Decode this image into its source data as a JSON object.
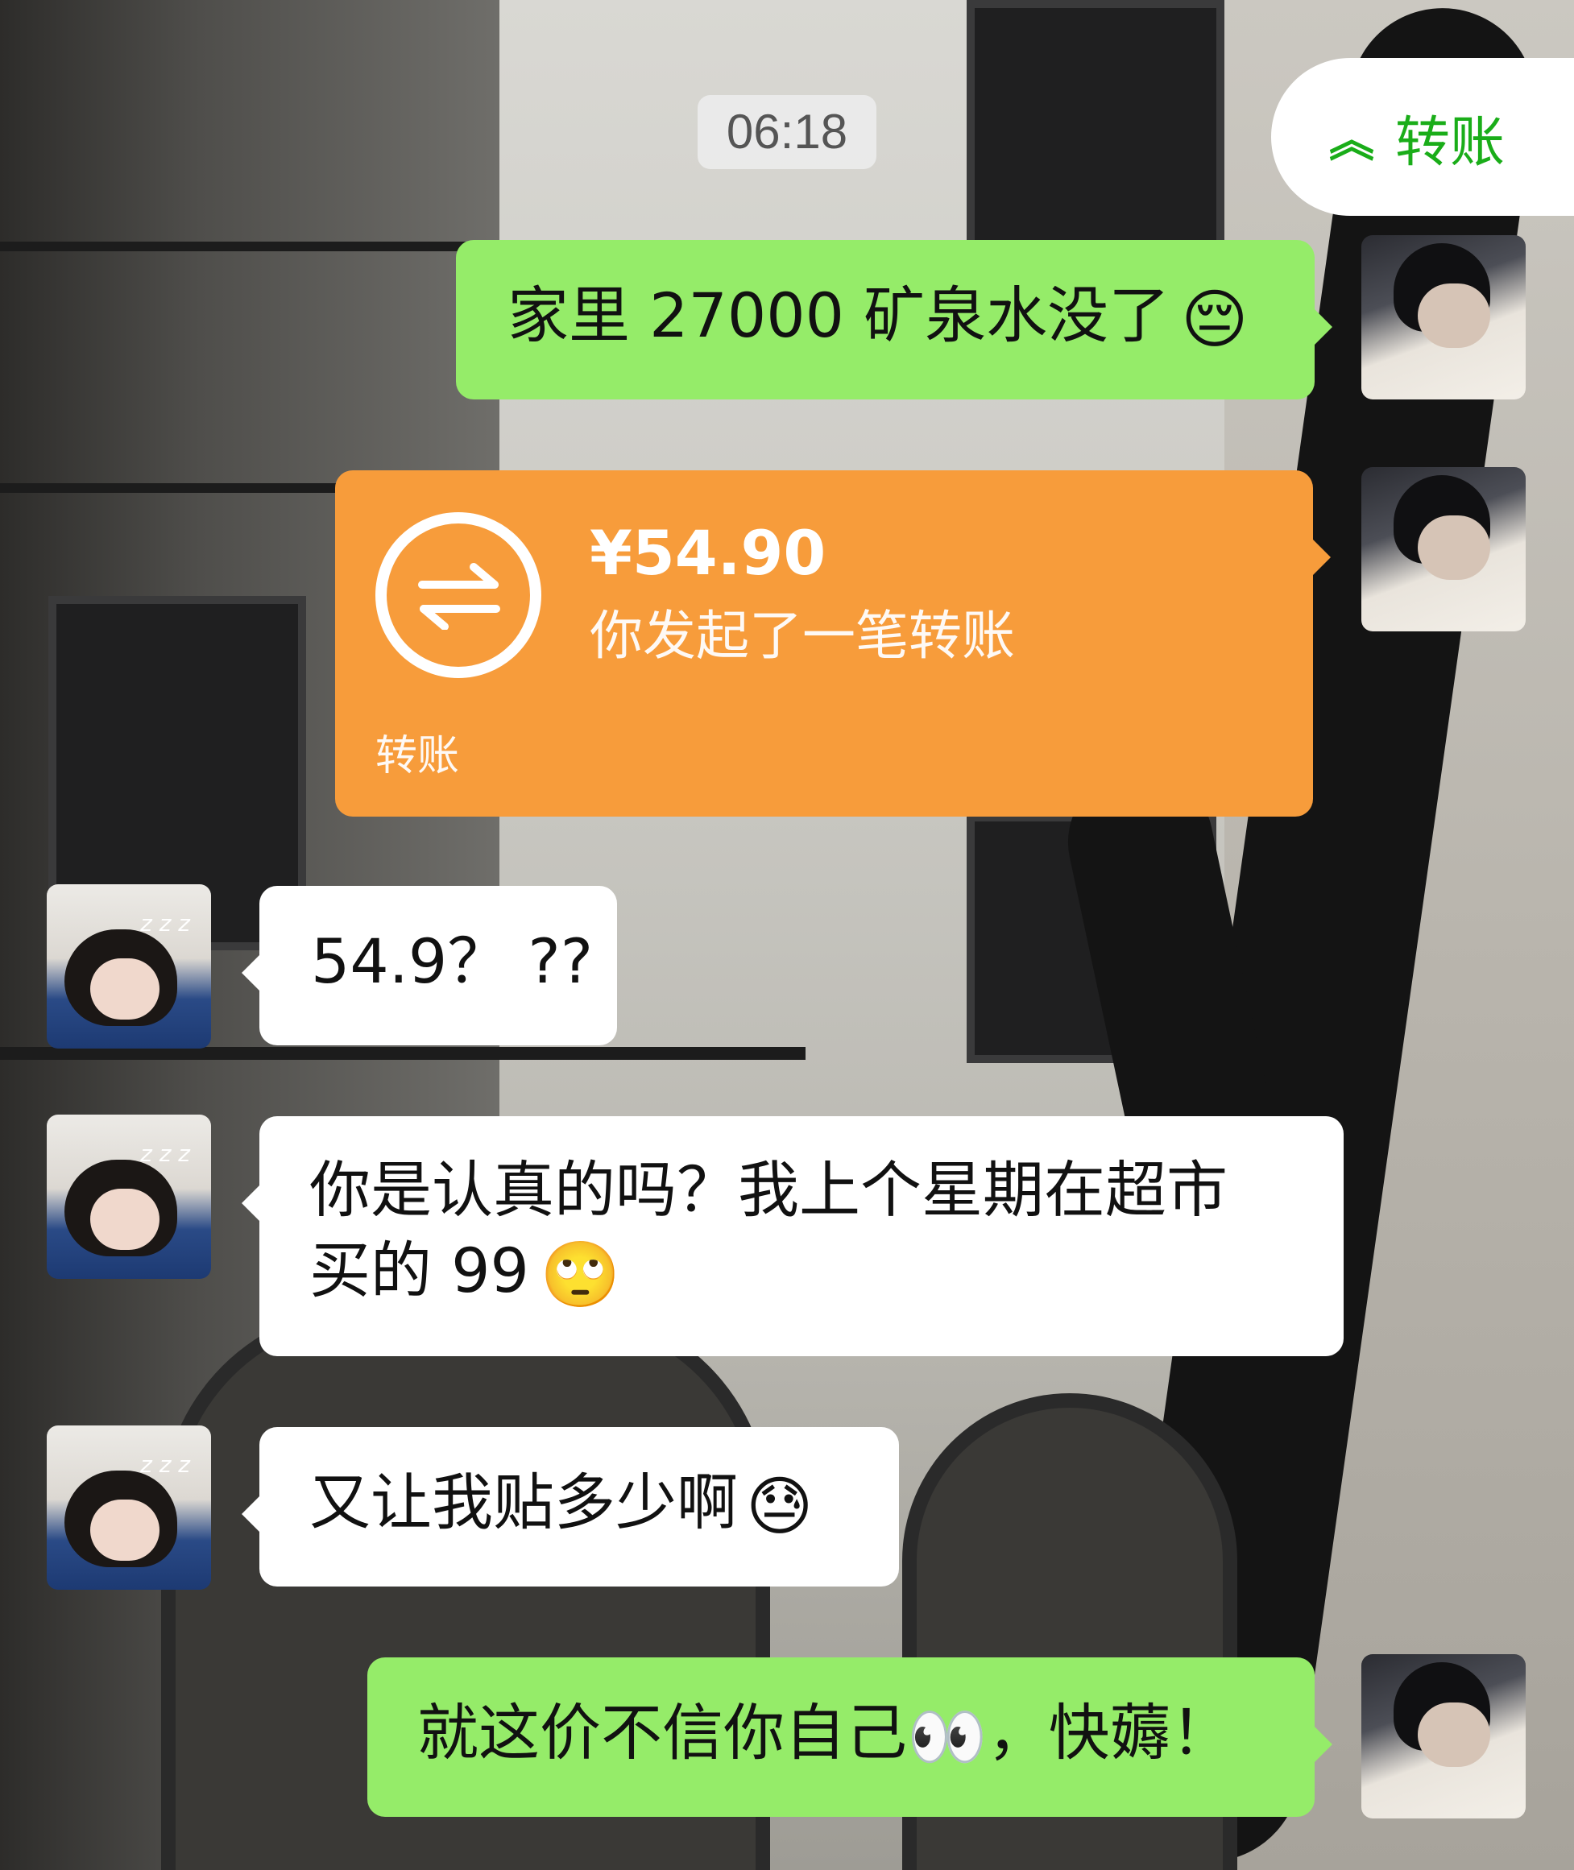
{
  "time_divider": "06:18",
  "transfer_chip": {
    "label": "转账",
    "icon": "chevron-up-double-icon",
    "color": "#1aad19"
  },
  "messages": [
    {
      "from": "me",
      "text": "家里 27000 矿泉水没了",
      "emoji": "😔"
    },
    {
      "from": "me",
      "type": "transfer",
      "amount": "¥54.90",
      "description": "你发起了一笔转账",
      "label": "转账",
      "icon": "transfer-arrows-icon"
    },
    {
      "from": "other",
      "text": "54.9？ ??"
    },
    {
      "from": "other",
      "text_line1": "你是认真的吗？我上个星期在超市",
      "text_line2": "买的 99",
      "emoji": "🙄"
    },
    {
      "from": "other",
      "text": "又让我贴多少啊",
      "emoji": "😓"
    },
    {
      "from": "me",
      "text": "就这价不信你自己",
      "emoji": "👀",
      "text_after": "，快薅！"
    }
  ],
  "avatars": {
    "other_badge": "z z z"
  },
  "colors": {
    "green_bubble": "#95ec69",
    "white_bubble": "#ffffff",
    "transfer_orange": "#f79c3b"
  }
}
